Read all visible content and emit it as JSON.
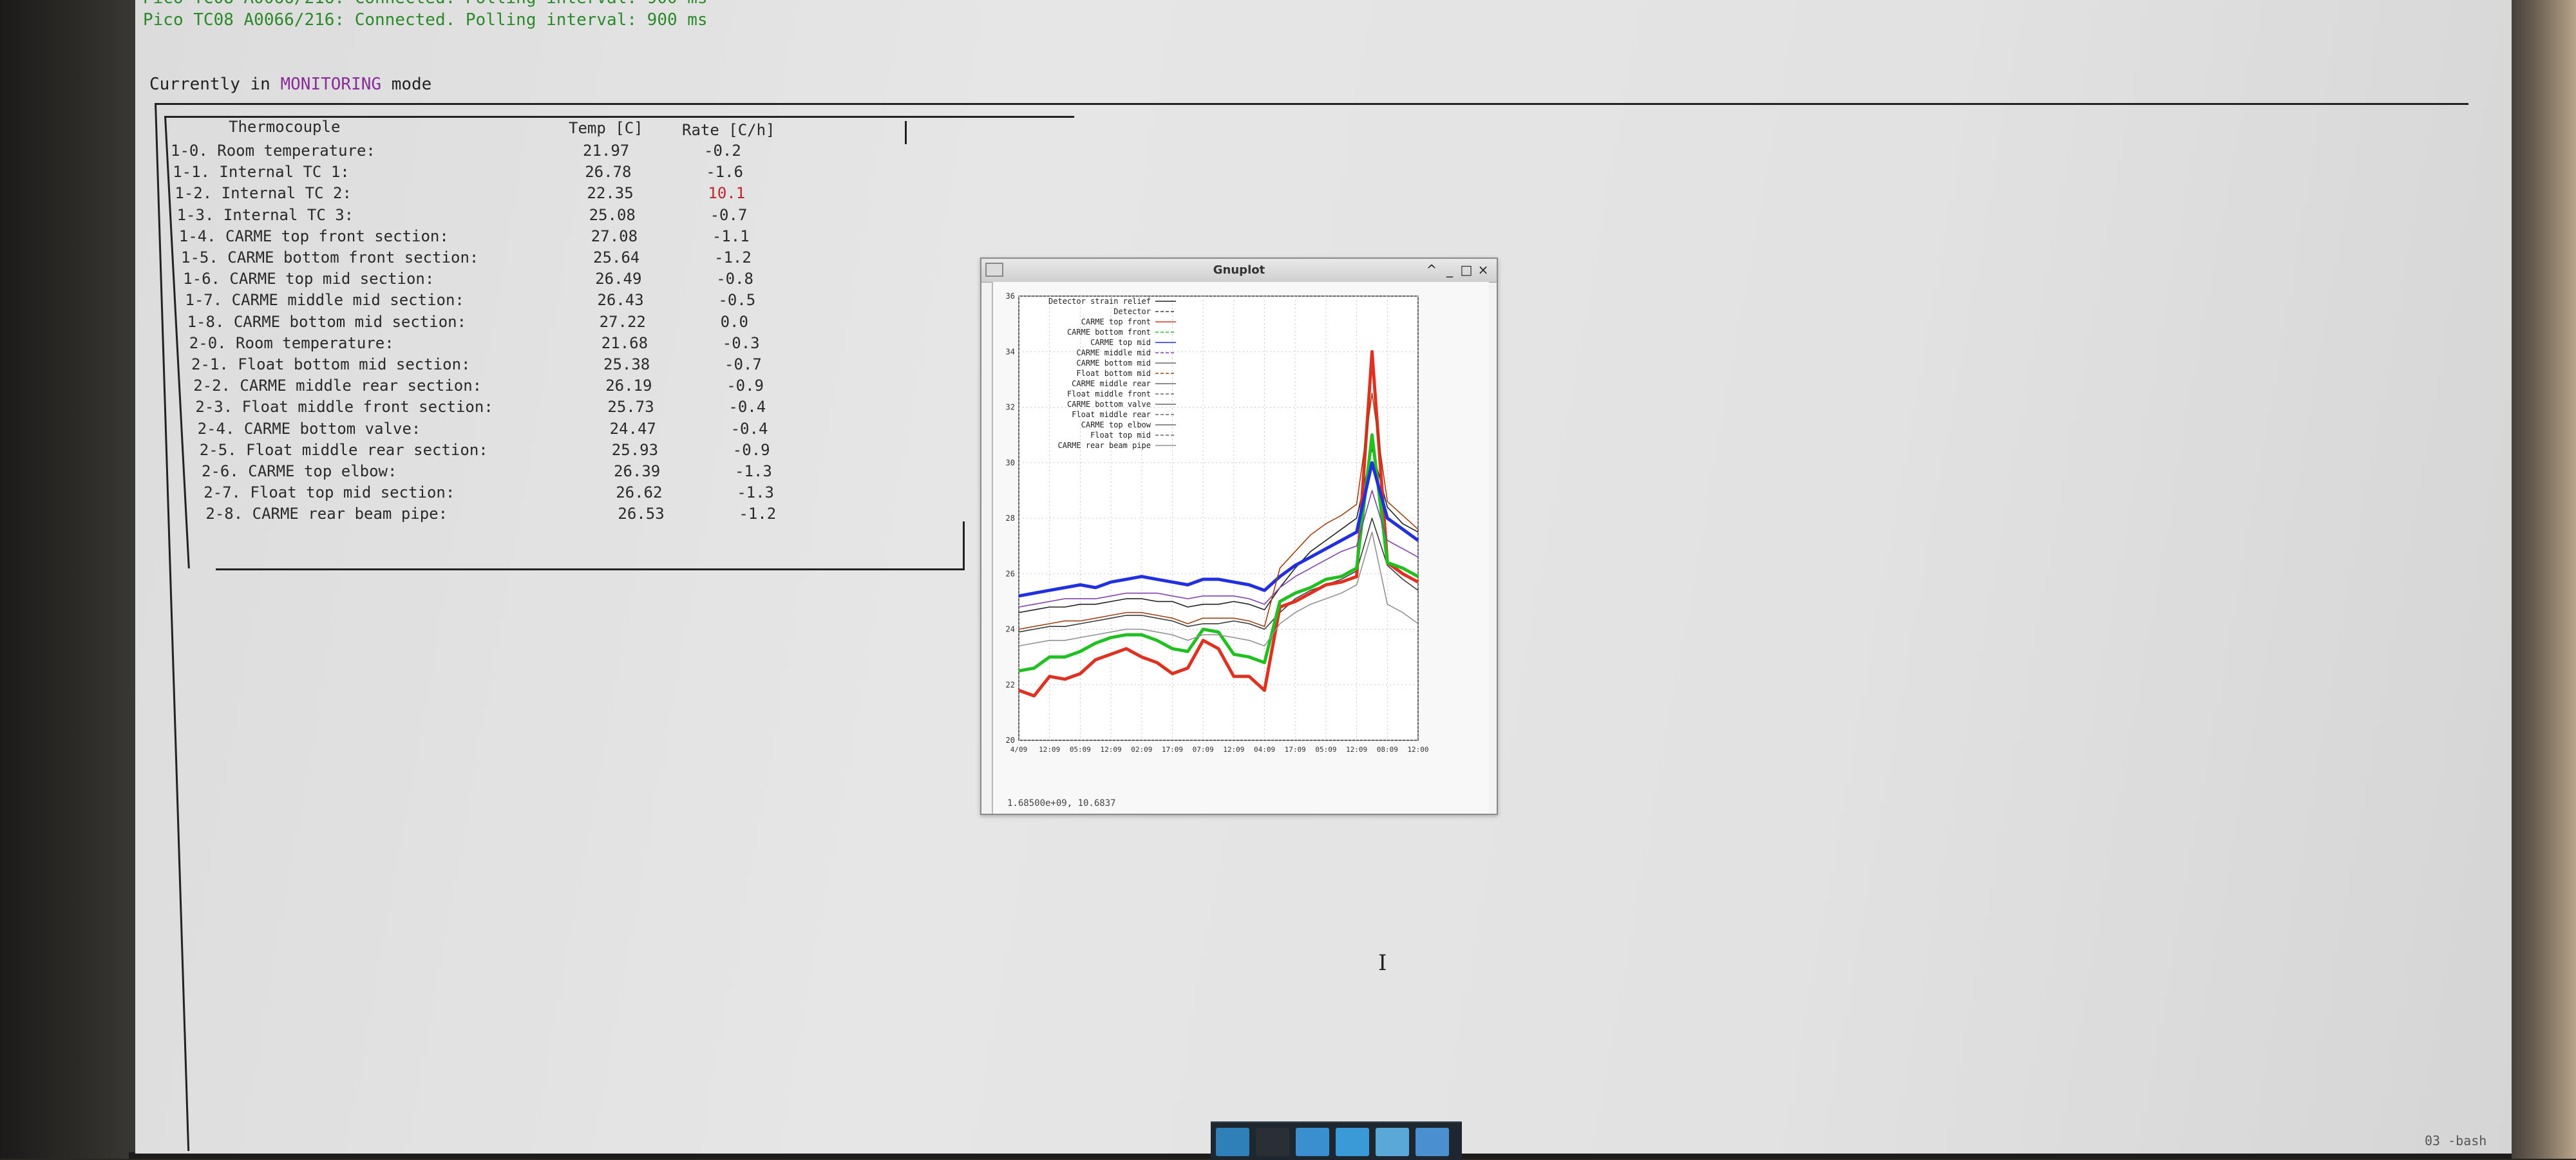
{
  "terminal": {
    "status_line_partial": "Pico TC08 A0066/216: Connected. Polling interval: 900 ms",
    "status_line": "Pico TC08 A0066/216: Connected. Polling interval: 900 ms",
    "mode_prefix": "Currently in ",
    "mode_value": "MONITORING",
    "mode_suffix": " mode"
  },
  "table": {
    "headers": {
      "name": "Thermocouple",
      "temp": "Temp [C]",
      "rate": "Rate [C/h]"
    },
    "rows": [
      {
        "name": "1-0. Room temperature:",
        "temp": "21.97",
        "rate": "-0.2"
      },
      {
        "name": "1-1. Internal TC 1:",
        "temp": "26.78",
        "rate": "-1.6"
      },
      {
        "name": "1-2. Internal TC 2:",
        "temp": "22.35",
        "rate": "10.1"
      },
      {
        "name": "1-3. Internal TC 3:",
        "temp": "25.08",
        "rate": "-0.7"
      },
      {
        "name": "1-4. CARME top front section:",
        "temp": "27.08",
        "rate": "-1.1"
      },
      {
        "name": "1-5. CARME bottom front section:",
        "temp": "25.64",
        "rate": "-1.2"
      },
      {
        "name": "1-6. CARME top mid section:",
        "temp": "26.49",
        "rate": "-0.8"
      },
      {
        "name": "1-7. CARME middle mid section:",
        "temp": "26.43",
        "rate": "-0.5"
      },
      {
        "name": "1-8. CARME bottom mid section:",
        "temp": "27.22",
        "rate": "0.0"
      },
      {
        "name": "2-0. Room temperature:",
        "temp": "21.68",
        "rate": "-0.3"
      },
      {
        "name": "2-1. Float bottom mid section:",
        "temp": "25.38",
        "rate": "-0.7"
      },
      {
        "name": "2-2. CARME middle rear section:",
        "temp": "26.19",
        "rate": "-0.9"
      },
      {
        "name": "2-3. Float middle front section:",
        "temp": "25.73",
        "rate": "-0.4"
      },
      {
        "name": "2-4. CARME bottom valve:",
        "temp": "24.47",
        "rate": "-0.4"
      },
      {
        "name": "2-5. Float middle rear section:",
        "temp": "25.93",
        "rate": "-0.9"
      },
      {
        "name": "2-6. CARME top elbow:",
        "temp": "26.39",
        "rate": "-1.3"
      },
      {
        "name": "2-7. Float top mid section:",
        "temp": "26.62",
        "rate": "-1.3"
      },
      {
        "name": "2-8. CARME rear beam pipe:",
        "temp": "26.53",
        "rate": "-1.2"
      }
    ],
    "highlight_color": "#c0262a"
  },
  "gnuplot": {
    "window_title": "Gnuplot",
    "buttons": {
      "menu": "^",
      "minimize": "_",
      "maximize": "□",
      "close": "×"
    },
    "status_readout": "1.68500e+09,  10.6837"
  },
  "chart_data": {
    "type": "line",
    "title": "",
    "xlabel": "",
    "ylabel": "",
    "ylim": [
      20,
      36
    ],
    "y_ticks": [
      "20",
      "22",
      "24",
      "26",
      "28",
      "30",
      "32",
      "34",
      "36"
    ],
    "x_ticks": [
      "4/09",
      "12:09",
      "05:09",
      "12:09",
      "02:09",
      "17:09",
      "07:09",
      "12:09",
      "04:09",
      "17:09",
      "05:09",
      "12:09",
      "08:09",
      "12:00"
    ],
    "grid": true,
    "legend_position": "top-left",
    "x": [
      0,
      0.5,
      1,
      1.5,
      2,
      2.5,
      3,
      3.5,
      4,
      4.5,
      5,
      5.5,
      6,
      6.5,
      7,
      7.5,
      8,
      8.5,
      9,
      9.5,
      10,
      10.5,
      11,
      11.5,
      12,
      12.5,
      13
    ],
    "series": [
      {
        "name": "Detector strain relief",
        "color": "#202020",
        "values": [
          24.6,
          24.7,
          24.8,
          24.8,
          24.9,
          24.9,
          25.0,
          25.1,
          25.1,
          25.0,
          25.0,
          24.8,
          24.9,
          24.9,
          25.0,
          24.9,
          24.7,
          25.5,
          26.2,
          26.8,
          27.2,
          27.6,
          28.0,
          30.5,
          28.4,
          27.8,
          27.5
        ]
      },
      {
        "name": "Detector",
        "color": "#3a3a3a",
        "values": [
          23.9,
          24.0,
          24.1,
          24.1,
          24.2,
          24.3,
          24.4,
          24.5,
          24.5,
          24.4,
          24.3,
          24.1,
          24.2,
          24.2,
          24.3,
          24.2,
          24.0,
          24.6,
          25.1,
          25.4,
          25.6,
          25.8,
          26.1,
          28.0,
          26.3,
          25.8,
          25.4
        ]
      },
      {
        "name": "CARME top front",
        "color": "#e03020",
        "values": [
          21.8,
          21.6,
          22.3,
          22.2,
          22.4,
          22.9,
          23.1,
          23.3,
          23.0,
          22.8,
          22.4,
          22.6,
          23.6,
          23.3,
          22.3,
          22.3,
          21.8,
          24.8,
          25.0,
          25.3,
          25.6,
          25.7,
          25.9,
          34.0,
          26.4,
          26.0,
          25.7
        ]
      },
      {
        "name": "CARME bottom front",
        "color": "#20c020",
        "values": [
          22.5,
          22.6,
          23.0,
          23.0,
          23.2,
          23.5,
          23.7,
          23.8,
          23.8,
          23.6,
          23.3,
          23.2,
          24.0,
          23.9,
          23.1,
          23.0,
          22.8,
          25.0,
          25.3,
          25.5,
          25.8,
          25.9,
          26.2,
          31.0,
          26.4,
          26.2,
          25.9
        ]
      },
      {
        "name": "CARME top mid",
        "color": "#2030e0",
        "values": [
          25.2,
          25.3,
          25.4,
          25.5,
          25.6,
          25.5,
          25.7,
          25.8,
          25.9,
          25.8,
          25.7,
          25.6,
          25.8,
          25.8,
          25.7,
          25.6,
          25.4,
          25.9,
          26.3,
          26.6,
          26.9,
          27.2,
          27.5,
          30.0,
          28.0,
          27.6,
          27.2
        ]
      },
      {
        "name": "CARME middle mid",
        "color": "#8040b0",
        "values": [
          24.8,
          24.9,
          25.0,
          25.1,
          25.1,
          25.1,
          25.2,
          25.3,
          25.3,
          25.3,
          25.2,
          25.1,
          25.2,
          25.2,
          25.2,
          25.1,
          24.9,
          25.5,
          25.9,
          26.2,
          26.5,
          26.8,
          27.0,
          29.0,
          27.2,
          26.9,
          26.6
        ]
      },
      {
        "name": "Float bottom mid",
        "color": "#a04010",
        "values": [
          24.0,
          24.1,
          24.2,
          24.3,
          24.3,
          24.4,
          24.5,
          24.6,
          24.6,
          24.5,
          24.4,
          24.2,
          24.4,
          24.4,
          24.4,
          24.3,
          24.1,
          26.2,
          26.8,
          27.4,
          27.8,
          28.1,
          28.5,
          32.5,
          28.6,
          28.1,
          27.6
        ]
      },
      {
        "name": "CARME rear beam pipe",
        "color": "#909090",
        "values": [
          23.4,
          23.5,
          23.6,
          23.6,
          23.7,
          23.8,
          23.9,
          24.0,
          24.0,
          23.9,
          23.8,
          23.6,
          23.8,
          23.8,
          23.7,
          23.6,
          23.4,
          24.2,
          24.6,
          24.9,
          25.1,
          25.3,
          25.6,
          27.5,
          24.9,
          24.6,
          24.2
        ]
      }
    ],
    "legend_entries": [
      "Detector strain relief",
      "Detector",
      "CARME top front",
      "CARME bottom front",
      "CARME top mid",
      "CARME middle mid",
      "CARME bottom mid",
      "Float bottom mid",
      "CARME middle rear",
      "Float middle front",
      "CARME bottom valve",
      "Float middle rear",
      "CARME top elbow",
      "Float top mid",
      "CARME rear beam pipe"
    ]
  },
  "taskbar": {
    "items": [
      {
        "icon": "desktop-icon",
        "color": "#2f7fb8"
      },
      {
        "icon": "terminal-icon",
        "color": "#2a2f36"
      },
      {
        "icon": "document-icon",
        "color": "#3a8fd0"
      },
      {
        "icon": "browser-globe-icon",
        "color": "#3a9ad8"
      },
      {
        "icon": "search-magnifier-icon",
        "color": "#5aa8d8"
      },
      {
        "icon": "folder-icon",
        "color": "#4a90d0"
      }
    ],
    "workspace_label": "03 -bash"
  }
}
